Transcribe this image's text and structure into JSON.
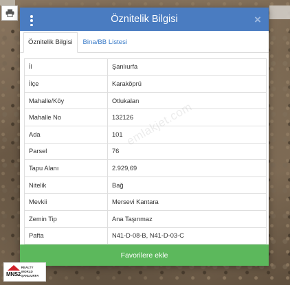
{
  "modal": {
    "title": "Öznitelik Bilgisi",
    "close_label": "×",
    "tabs": [
      {
        "label": "Öznitelik Bilgisi"
      },
      {
        "label": "Bina/BB Listesi"
      }
    ],
    "rows": [
      {
        "key": "İl",
        "value": "Şanlıurfa"
      },
      {
        "key": "İlçe",
        "value": "Karaköprü"
      },
      {
        "key": "Mahalle/Köy",
        "value": "Otlukalan"
      },
      {
        "key": "Mahalle No",
        "value": "132126"
      },
      {
        "key": "Ada",
        "value": "101"
      },
      {
        "key": "Parsel",
        "value": "76"
      },
      {
        "key": "Tapu Alanı",
        "value": "2.929,69"
      },
      {
        "key": "Nitelik",
        "value": "Bağ"
      },
      {
        "key": "Mevkii",
        "value": "Mersevi Kantara"
      },
      {
        "key": "Zemin Tip",
        "value": "Ana Taşınmaz"
      },
      {
        "key": "Pafta",
        "value": "N41-D-08-B, N41-D-03-C"
      }
    ],
    "action_label": "Favorilere ekle",
    "watermark": "emlakjet.com"
  },
  "logo": {
    "mark": "MNS2",
    "line1": "REALTY WORLD",
    "line2": "ŞANLIURFA"
  },
  "colors": {
    "header": "#4a7cc1",
    "action": "#5cb85c",
    "tab_link": "#3a7bc8"
  }
}
